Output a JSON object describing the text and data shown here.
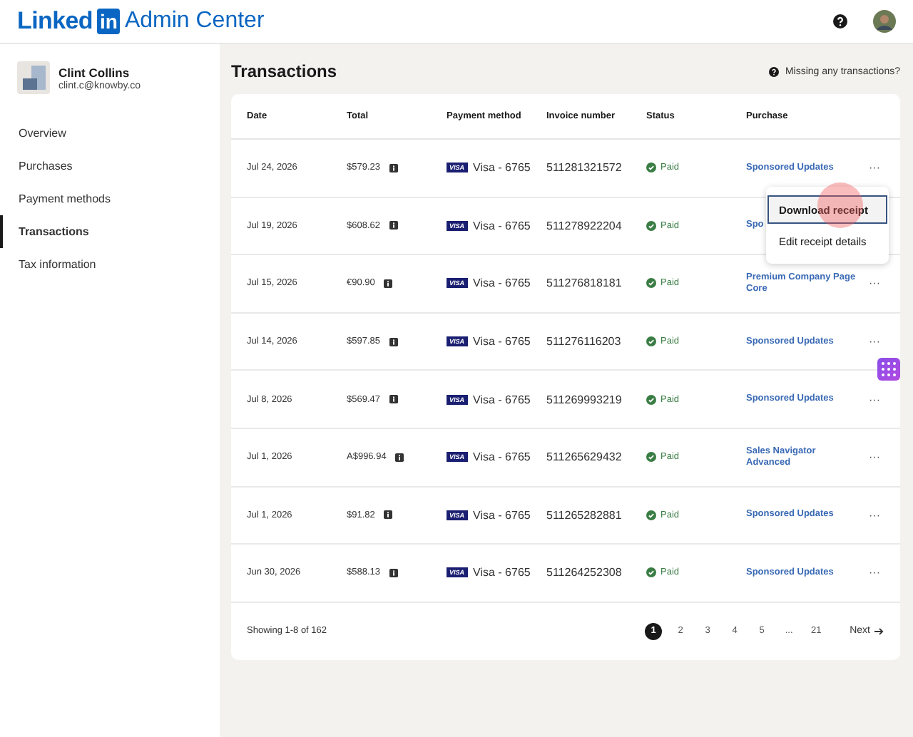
{
  "header": {
    "logo_text": "Linked",
    "logo_badge": "in",
    "title": "Admin Center"
  },
  "sidebar": {
    "user": {
      "name": "Clint Collins",
      "email": "clint.c@knowby.co"
    },
    "items": [
      {
        "label": "Overview",
        "selected": false
      },
      {
        "label": "Purchases",
        "selected": false
      },
      {
        "label": "Payment methods",
        "selected": false
      },
      {
        "label": "Transactions",
        "selected": true
      },
      {
        "label": "Tax information",
        "selected": false
      }
    ]
  },
  "page": {
    "title": "Transactions",
    "help_link": "Missing any transactions?"
  },
  "table": {
    "columns": [
      "Date",
      "Total",
      "Payment method",
      "Invoice number",
      "Status",
      "Purchase"
    ],
    "rows": [
      {
        "date": "Jul 24, 2026",
        "total": "$579.23",
        "card_brand": "VISA",
        "card": "Visa - 6765",
        "invoice": "511281321572",
        "status": "Paid",
        "purchase": "Sponsored Updates",
        "more": "···"
      },
      {
        "date": "Jul 19, 2026",
        "total": "$608.62",
        "card_brand": "VISA",
        "card": "Visa - 6765",
        "invoice": "511278922204",
        "status": "Paid",
        "purchase": "Spo"
      },
      {
        "date": "Jul 15, 2026",
        "total": "€90.90",
        "card_brand": "VISA",
        "card": "Visa - 6765",
        "invoice": "511276818181",
        "status": "Paid",
        "purchase": "Premium Company Page Core",
        "more": "···"
      },
      {
        "date": "Jul 14, 2026",
        "total": "$597.85",
        "card_brand": "VISA",
        "card": "Visa - 6765",
        "invoice": "511276116203",
        "status": "Paid",
        "purchase": "Sponsored Updates",
        "more": "···"
      },
      {
        "date": "Jul 8, 2026",
        "total": "$569.47",
        "card_brand": "VISA",
        "card": "Visa - 6765",
        "invoice": "511269993219",
        "status": "Paid",
        "purchase": "Sponsored Updates",
        "more": "···"
      },
      {
        "date": "Jul 1, 2026",
        "total": "A$996.94",
        "card_brand": "VISA",
        "card": "Visa - 6765",
        "invoice": "511265629432",
        "status": "Paid",
        "purchase": "Sales Navigator Advanced",
        "more": "···"
      },
      {
        "date": "Jul 1, 2026",
        "total": "$91.82",
        "card_brand": "VISA",
        "card": "Visa - 6765",
        "invoice": "511265282881",
        "status": "Paid",
        "purchase": "Sponsored Updates",
        "more": "···"
      },
      {
        "date": "Jun 30, 2026",
        "total": "$588.13",
        "card_brand": "VISA",
        "card": "Visa - 6765",
        "invoice": "511264252308",
        "status": "Paid",
        "purchase": "Sponsored Updates",
        "more": "···"
      }
    ]
  },
  "footer": {
    "showing": "Showing 1-8 of 162",
    "pages": [
      {
        "label": "1",
        "selected": true
      },
      {
        "label": "2",
        "selected": false
      },
      {
        "label": "3",
        "selected": false
      },
      {
        "label": "4",
        "selected": false
      },
      {
        "label": "5",
        "selected": false
      },
      {
        "label": "...",
        "selected": false
      },
      {
        "label": "21",
        "selected": false
      }
    ],
    "next": "Next"
  },
  "menu": {
    "items": [
      {
        "label": "Download receipt",
        "selected": true
      },
      {
        "label": "Edit receipt details",
        "selected": false
      }
    ]
  }
}
